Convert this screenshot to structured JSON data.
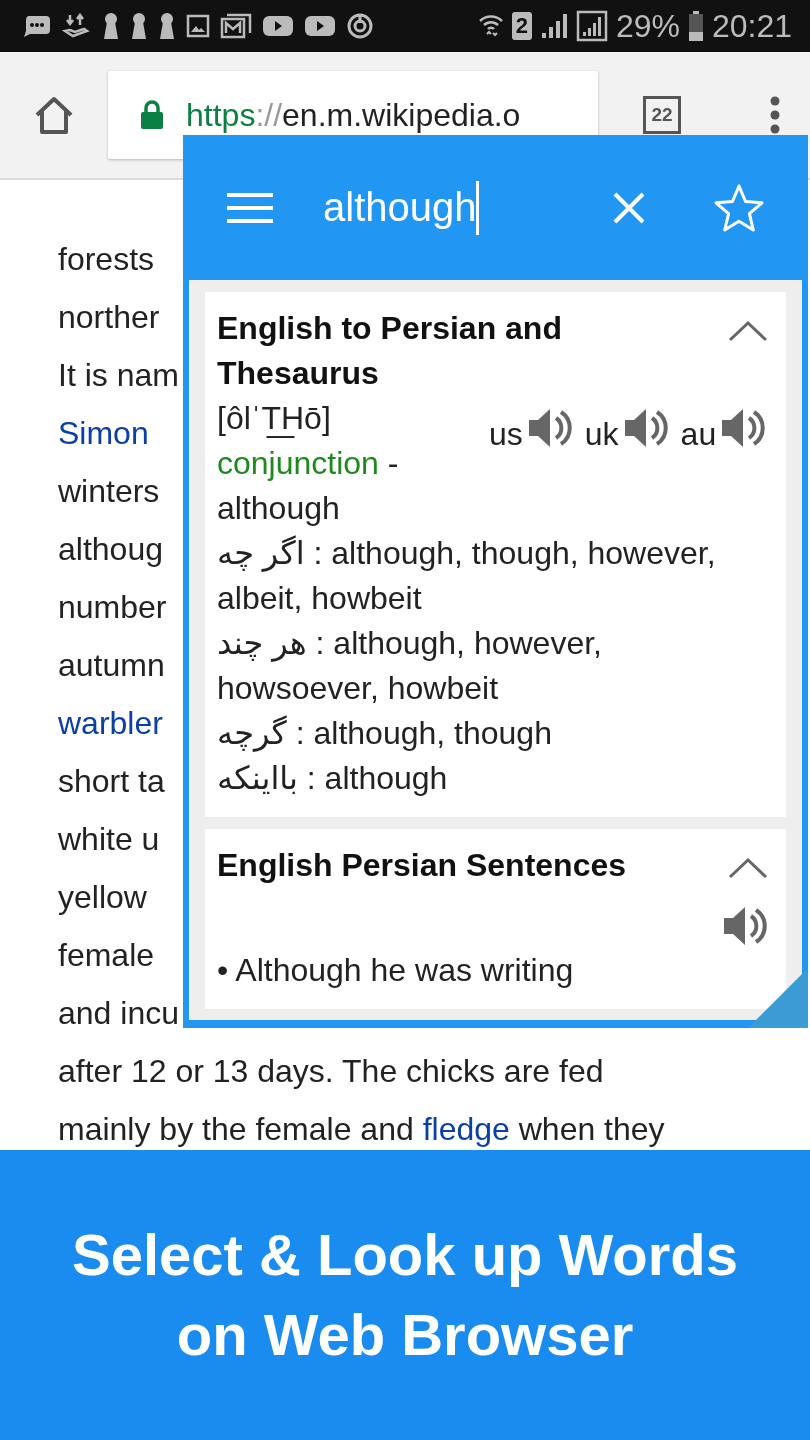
{
  "status_bar": {
    "sim": "2",
    "battery": "29%",
    "time": "20:21"
  },
  "browser": {
    "url_scheme": "https",
    "url_separator": "://",
    "url_host": "en.m.wikipedia.o",
    "tab_count": "22"
  },
  "article": {
    "lines": [
      {
        "segments": [
          {
            "text": "forests",
            "link": false
          }
        ]
      },
      {
        "segments": [
          {
            "text": "norther",
            "link": false
          }
        ]
      },
      {
        "segments": [
          {
            "text": "It is nam",
            "link": false
          }
        ]
      },
      {
        "segments": [
          {
            "text": "Simon",
            "link": true
          }
        ]
      },
      {
        "segments": [
          {
            "text": "winters",
            "link": false
          }
        ]
      },
      {
        "segments": [
          {
            "text": "althoug",
            "link": false
          }
        ]
      },
      {
        "segments": [
          {
            "text": "number",
            "link": false
          }
        ]
      },
      {
        "segments": [
          {
            "text": "autumn",
            "link": false
          }
        ]
      },
      {
        "segments": [
          {
            "text": "warbler",
            "link": true
          }
        ]
      },
      {
        "segments": [
          {
            "text": "short ta",
            "link": false
          }
        ]
      },
      {
        "segments": [
          {
            "text": "white u",
            "link": false
          }
        ]
      },
      {
        "segments": [
          {
            "text": "yellow",
            "link": false
          }
        ]
      },
      {
        "segments": [
          {
            "text": "female",
            "link": false
          }
        ]
      },
      {
        "segments": [
          {
            "text": "and incu",
            "link": false
          }
        ]
      },
      {
        "segments": [
          {
            "text": "after 12 or 13 days. The chicks are fed",
            "link": false
          }
        ]
      },
      {
        "segments": [
          {
            "text": "mainly by the female and ",
            "link": false
          },
          {
            "text": "fledge",
            "link": true
          },
          {
            "text": " when they",
            "link": false
          }
        ]
      }
    ]
  },
  "popup": {
    "search": {
      "value": "although"
    },
    "entries": [
      {
        "kind": "dictionary",
        "title": "English to Persian and Thesaurus",
        "expanded": true,
        "pronunciation": "[ôlˈT͟Hō]",
        "audio": [
          {
            "label": "us"
          },
          {
            "label": "uk"
          },
          {
            "label": "au"
          }
        ],
        "part_of_speech": "conjunction",
        "gloss": " - although",
        "definitions": [
          "اگر چه : although, though, however, albeit, howbeit",
          "هر چند : although, however, howsoever, howbeit",
          "گرچه : although, though",
          "بااینکه : although"
        ]
      },
      {
        "kind": "sentences",
        "title": "English Persian Sentences",
        "expanded": true,
        "sentences": [
          "• Although he was writing"
        ]
      }
    ]
  },
  "caption": "Select & Look up Words on Web Browser"
}
